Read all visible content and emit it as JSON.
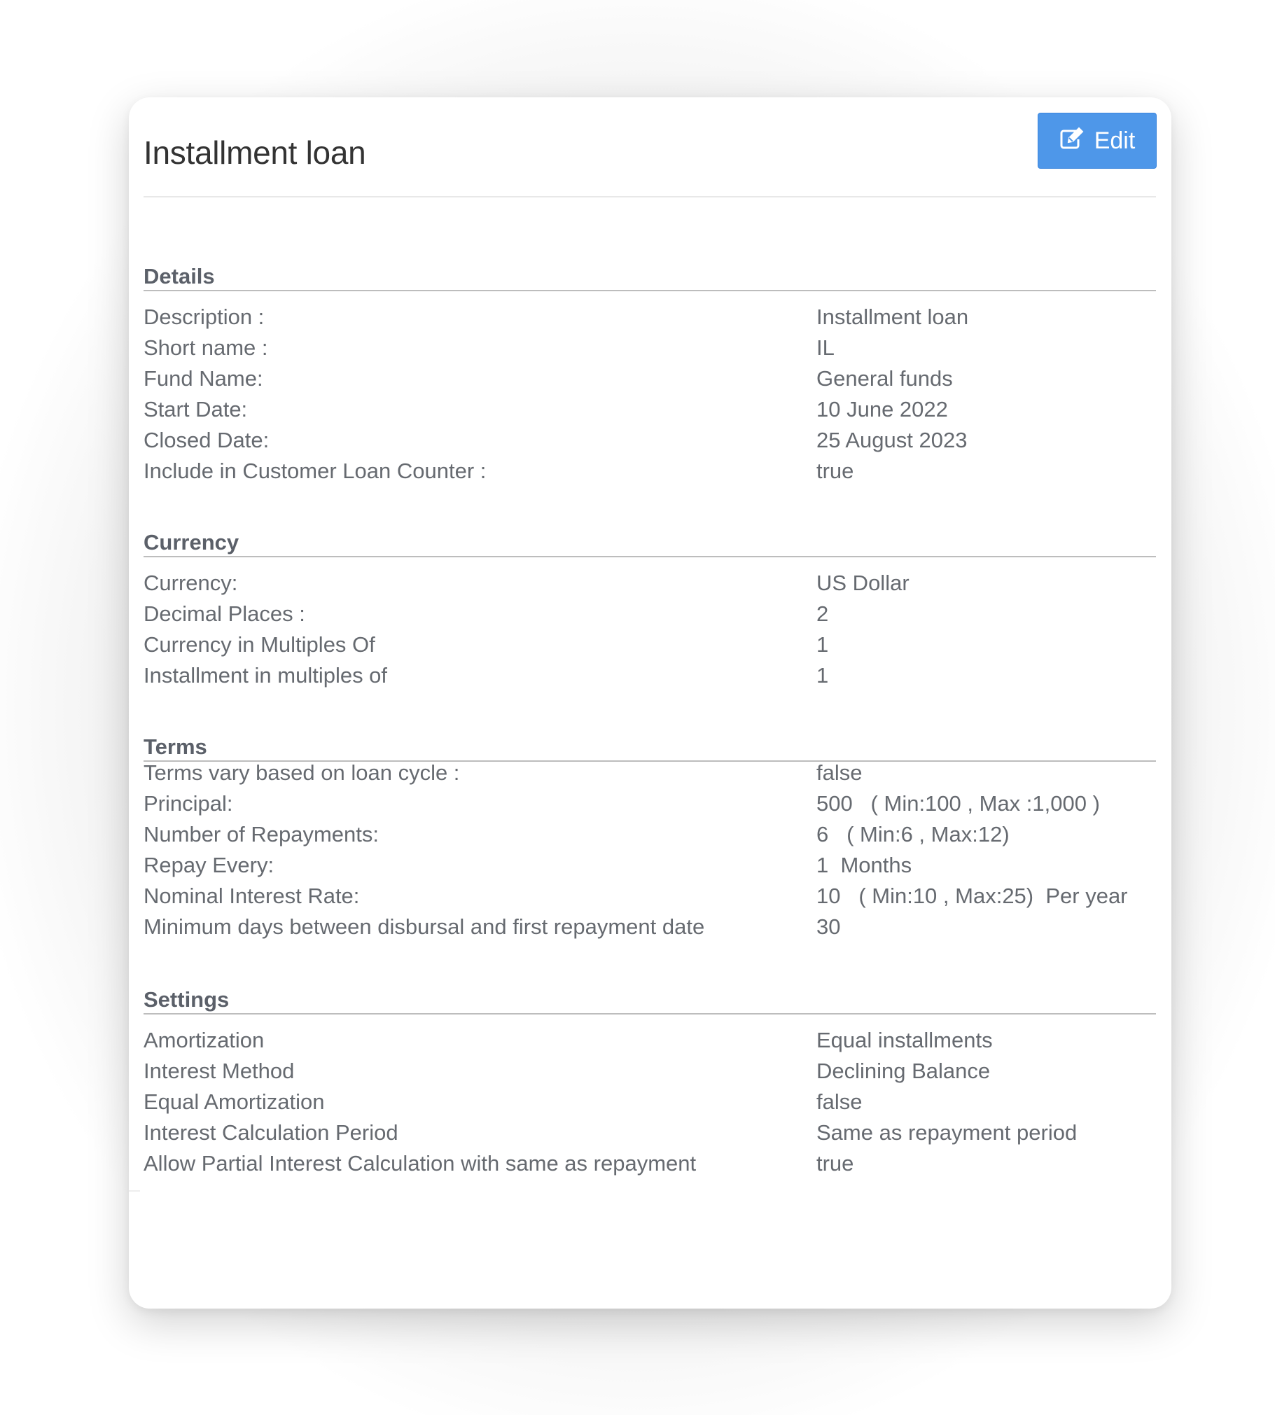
{
  "page": {
    "title": "Installment loan",
    "edit_button": {
      "label": "Edit",
      "icon": "edit-icon"
    }
  },
  "sections": {
    "details": {
      "heading": "Details",
      "rows": [
        {
          "label": "Description :",
          "value": "Installment loan"
        },
        {
          "label": "Short name :",
          "value": "IL"
        },
        {
          "label": "Fund Name:",
          "value": "General funds"
        },
        {
          "label": "Start Date:",
          "value": "10 June 2022"
        },
        {
          "label": "Closed Date:",
          "value": "25 August 2023"
        },
        {
          "label": "Include in Customer Loan Counter :",
          "value": "true"
        }
      ]
    },
    "currency": {
      "heading": "Currency",
      "rows": [
        {
          "label": "Currency:",
          "value": "US Dollar"
        },
        {
          "label": "Decimal Places :",
          "value": "2"
        },
        {
          "label": "Currency in Multiples Of",
          "value": "1"
        },
        {
          "label": "Installment in multiples of",
          "value": "1"
        }
      ]
    },
    "terms": {
      "heading": "Terms",
      "rows": [
        {
          "label": "Terms vary based on loan cycle :",
          "value": "false"
        },
        {
          "label": "Principal:",
          "value": "500   ( Min:100 , Max :1,000 )"
        },
        {
          "label": "Number of Repayments:",
          "value": "6   ( Min:6 , Max:12)"
        },
        {
          "label": "Repay Every:",
          "value": "1  Months"
        },
        {
          "label": "Nominal Interest Rate:",
          "value": "10   ( Min:10 , Max:25)  Per year"
        },
        {
          "label": "Minimum days between disbursal and first repayment date",
          "value": "30"
        }
      ]
    },
    "settings": {
      "heading": "Settings",
      "rows": [
        {
          "label": "Amortization",
          "value": "Equal installments"
        },
        {
          "label": "Interest Method",
          "value": "Declining Balance"
        },
        {
          "label": "Equal Amortization",
          "value": "false"
        },
        {
          "label": "Interest Calculation Period",
          "value": "Same as repayment period"
        },
        {
          "label": "Allow Partial Interest Calculation with same as repayment",
          "value": "true"
        }
      ]
    }
  },
  "colors": {
    "accent": "#4e97e9",
    "text": "#666a70",
    "heading": "#5b6069",
    "title": "#333333"
  }
}
